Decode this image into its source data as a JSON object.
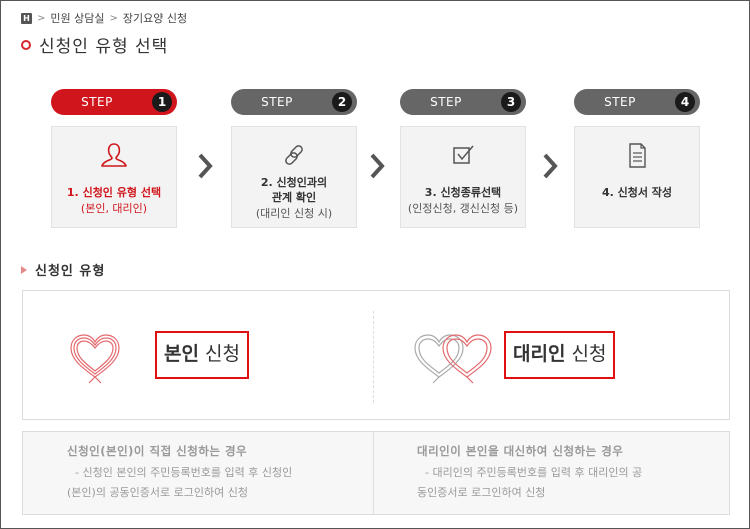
{
  "breadcrumb": {
    "home_icon": "H",
    "items": [
      "민원 상담실",
      "장기요양 신청"
    ]
  },
  "page_title": "신청인 유형 선택",
  "steps": [
    {
      "label": "STEP",
      "number": "1",
      "title": "1. 신청인 유형 선택",
      "sub": "(본인, 대리인)",
      "icon": "person-icon",
      "active": true
    },
    {
      "label": "STEP",
      "number": "2",
      "title_line1": "2. 신청인과의",
      "title_line2": "관계 확인",
      "sub": "(대리인 신청 시)",
      "icon": "link-icon",
      "active": false
    },
    {
      "label": "STEP",
      "number": "3",
      "title": "3. 신청종류선택",
      "sub": "(인정신청, 갱신신청 등)",
      "icon": "checkbox-icon",
      "active": false
    },
    {
      "label": "STEP",
      "number": "4",
      "title": "4. 신청서 작성",
      "icon": "document-icon",
      "active": false
    }
  ],
  "section_title": "신청인 유형",
  "options": {
    "self": {
      "bold": "본인",
      "rest": " 신청"
    },
    "proxy": {
      "bold": "대리인",
      "rest": " 신청"
    }
  },
  "descriptions": {
    "self": {
      "title": "신청인(본인)이 직접 신청하는 경우",
      "line1": "- 신청인 본인의 주민등록번호를 입력 후 신청인",
      "line2": "(본인)의 공동인증서로 로그인하여 신청"
    },
    "proxy": {
      "title": "대리인이 본인을 대신하여 신청하는 경우",
      "line1": "- 대리인의 주민등록번호를 입력 후 대리인의 공",
      "line2": "동인증서로 로그인하여 신청"
    }
  },
  "colors": {
    "accent": "#d0161c",
    "inactive_pill": "#666666",
    "selection_border": "#e01010"
  }
}
